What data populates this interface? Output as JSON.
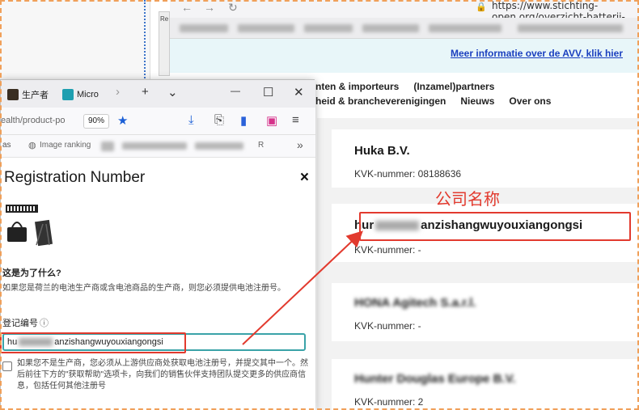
{
  "background_browser": {
    "url": "https://www.stichting-open.org/overzicht-batterij-partners/",
    "side_tab_label": "Re",
    "banner_link": "Meer informatie over de AVV, klik hier",
    "nav_row1": [
      "nten & importeurs",
      "(Inzamel)partners"
    ],
    "nav_row2": [
      "heid & brancheverenigingen",
      "Nieuws",
      "Over ons"
    ],
    "listings": [
      {
        "name": "Huka B.V.",
        "kvk": "KVK-nummer: 08188636"
      },
      {
        "name_prefix": "hur",
        "name_suffix": "anzishangwuyouxiangongsi",
        "kvk": "KVK-nummer: -"
      },
      {
        "name": "HONA Agitech S.a.r.l.",
        "kvk": "KVK-nummer: -"
      },
      {
        "name": "Hunter Douglas Europe B.V.",
        "kvk": "KVK-nummer: 2"
      }
    ],
    "annotation_label": "公司名称",
    "accent_red": "#e23a2e"
  },
  "popup": {
    "tabs": [
      {
        "label": "生产者",
        "icon": "page-icon"
      },
      {
        "label": "Micro",
        "icon": "app-icon"
      }
    ],
    "new_tab": "+",
    "tab_list": "⌄",
    "minimize": "—",
    "maximize": "☐",
    "close": "✕",
    "url_fragment": "ealth/product-po",
    "zoom": "90%",
    "bookmark_items": [
      "as",
      "Image ranking",
      "R",
      "»"
    ],
    "dialog": {
      "title": "Registration Number",
      "close": "×",
      "question": "这是为了什么?",
      "description": "如果您是荷兰的电池生产商或含电池商品的生产商，则您必须提供电池注册号。",
      "field_label": "登记编号",
      "input_prefix": "hu",
      "input_suffix": "anzishangwuyouxiangongsi",
      "checkbox_text": "如果您不是生产商，您必须从上游供应商处获取电池注册号，并提交其中一个。然后前往下方的\"获取帮助\"选项卡，向我们的销售伙伴支持团队提交更多的供应商信息，包括任何其他注册号"
    }
  }
}
